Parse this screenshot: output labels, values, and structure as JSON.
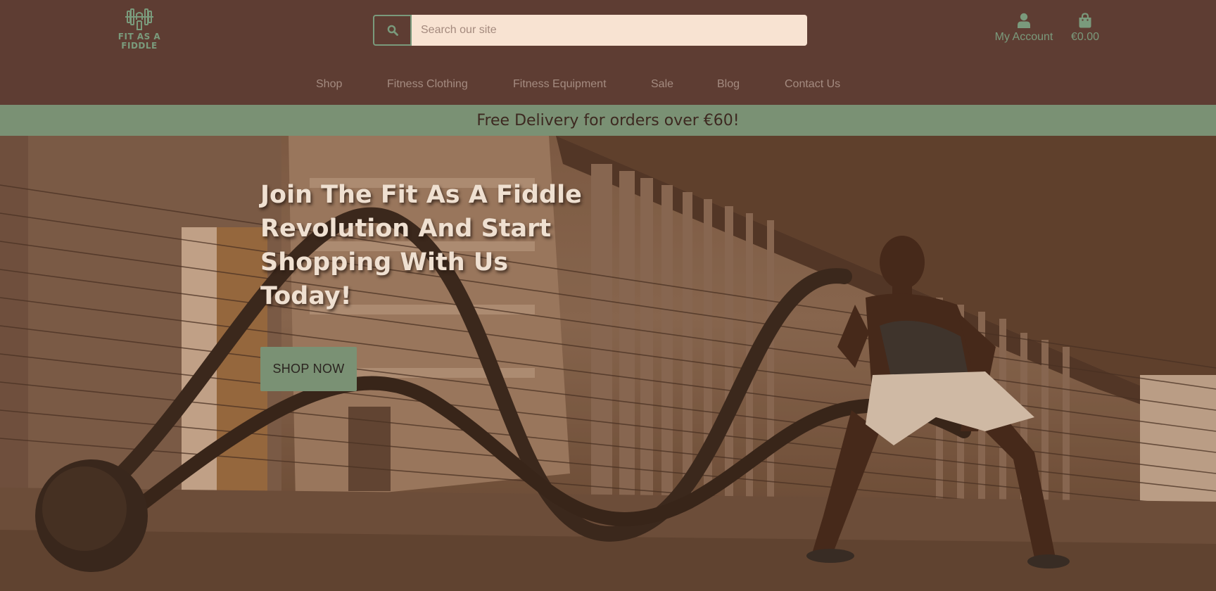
{
  "brand": {
    "logo_text": "FIT AS A FIDDLE",
    "logo_icon": "dumbbell-icon",
    "colors": {
      "header_bg": "#5e3d33",
      "accent_green": "#7a9a7c",
      "banner_bg": "#7a9174",
      "search_bg": "#f8e3d2",
      "hero_text": "#efe0d1"
    }
  },
  "search": {
    "placeholder": "Search our site",
    "value": "",
    "icon": "search-icon"
  },
  "account": {
    "label": "My Account",
    "icon": "user-icon"
  },
  "cart": {
    "label": "€0.00",
    "icon": "shopping-bag-icon"
  },
  "nav": {
    "items": [
      {
        "label": "Shop"
      },
      {
        "label": "Fitness Clothing"
      },
      {
        "label": "Fitness Equipment"
      },
      {
        "label": "Sale"
      },
      {
        "label": "Blog"
      },
      {
        "label": "Contact Us"
      }
    ]
  },
  "banner": {
    "text": "Free Delivery for orders over €60!"
  },
  "hero": {
    "title": "Join The Fit As A Fiddle Revolution And Start Shopping With Us Today!",
    "button_label": "SHOP NOW"
  }
}
